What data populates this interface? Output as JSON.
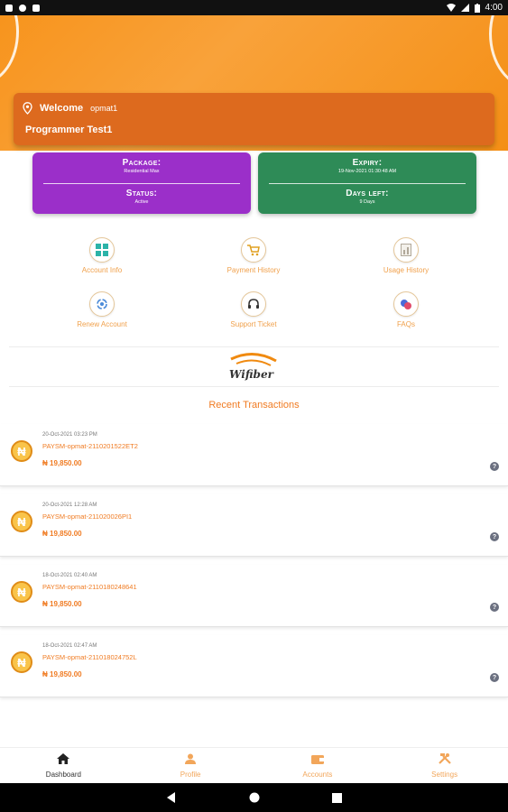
{
  "status_bar": {
    "time": "4:00"
  },
  "welcome": {
    "greeting": "Welcome",
    "username": "opmat1",
    "full_name": "Programmer Test1"
  },
  "package_card": {
    "package_label": "Package:",
    "package_value": "Residential Max",
    "status_label": "Status:",
    "status_value": "Active",
    "color": "#9b2fc9"
  },
  "expiry_card": {
    "expiry_label": "Expiry:",
    "expiry_value": "19-Nov-2021 01:30:48 AM",
    "days_label": "Days left:",
    "days_value": "9 Days",
    "color": "#2e8b57"
  },
  "quick_actions": [
    {
      "label": "Account Info",
      "icon": "grid-icon"
    },
    {
      "label": "Payment History",
      "icon": "cart-icon"
    },
    {
      "label": "Usage History",
      "icon": "chart-icon"
    },
    {
      "label": "Renew Account",
      "icon": "renew-icon"
    },
    {
      "label": "Support Ticket",
      "icon": "headset-icon"
    },
    {
      "label": "FAQs",
      "icon": "faq-icon"
    }
  ],
  "brand": {
    "name": "Wifiber"
  },
  "recent_transactions_title": "Recent Transactions",
  "transactions": [
    {
      "date": "20-Oct-2021 03:23 PM",
      "ref": "PAYSM-opmat-2110201522ET2",
      "amount": "₦ 19,850.00"
    },
    {
      "date": "20-Oct-2021 12:28 AM",
      "ref": "PAYSM-opmat-211020026PI1",
      "amount": "₦ 19,850.00"
    },
    {
      "date": "18-Oct-2021 02:40 AM",
      "ref": "PAYSM-opmat-2110180248641",
      "amount": "₦ 19,850.00"
    },
    {
      "date": "18-Oct-2021 02:47 AM",
      "ref": "PAYSM-opmat-211018024752L",
      "amount": "₦ 19,850.00"
    }
  ],
  "bottom_nav": [
    {
      "label": "Dashboard",
      "icon": "home-icon",
      "active": true
    },
    {
      "label": "Profile",
      "icon": "person-icon",
      "active": false
    },
    {
      "label": "Accounts",
      "icon": "wallet-icon",
      "active": false
    },
    {
      "label": "Settings",
      "icon": "tools-icon",
      "active": false
    }
  ],
  "colors": {
    "accent": "#f07b22",
    "header": "#f7941d",
    "welcome_bar": "#dd6a1e"
  }
}
